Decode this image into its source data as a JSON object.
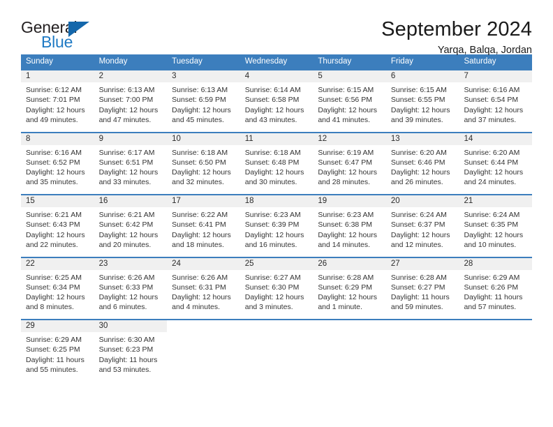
{
  "logo": {
    "part1": "General",
    "part2": "Blue",
    "triangle_icon": "blue-triangle-logo-mark",
    "color_dark": "#231f20",
    "color_blue": "#1f7ac4"
  },
  "header": {
    "title": "September 2024",
    "subtitle": "Yarqa, Balqa, Jordan"
  },
  "theme": {
    "header_bar": "#3c7ebd",
    "day_band": "#f0f0f0",
    "text": "#333333"
  },
  "weekdays": [
    "Sunday",
    "Monday",
    "Tuesday",
    "Wednesday",
    "Thursday",
    "Friday",
    "Saturday"
  ],
  "weeks": [
    [
      {
        "day": "1",
        "sunrise": "Sunrise: 6:12 AM",
        "sunset": "Sunset: 7:01 PM",
        "daylight1": "Daylight: 12 hours",
        "daylight2": "and 49 minutes."
      },
      {
        "day": "2",
        "sunrise": "Sunrise: 6:13 AM",
        "sunset": "Sunset: 7:00 PM",
        "daylight1": "Daylight: 12 hours",
        "daylight2": "and 47 minutes."
      },
      {
        "day": "3",
        "sunrise": "Sunrise: 6:13 AM",
        "sunset": "Sunset: 6:59 PM",
        "daylight1": "Daylight: 12 hours",
        "daylight2": "and 45 minutes."
      },
      {
        "day": "4",
        "sunrise": "Sunrise: 6:14 AM",
        "sunset": "Sunset: 6:58 PM",
        "daylight1": "Daylight: 12 hours",
        "daylight2": "and 43 minutes."
      },
      {
        "day": "5",
        "sunrise": "Sunrise: 6:15 AM",
        "sunset": "Sunset: 6:56 PM",
        "daylight1": "Daylight: 12 hours",
        "daylight2": "and 41 minutes."
      },
      {
        "day": "6",
        "sunrise": "Sunrise: 6:15 AM",
        "sunset": "Sunset: 6:55 PM",
        "daylight1": "Daylight: 12 hours",
        "daylight2": "and 39 minutes."
      },
      {
        "day": "7",
        "sunrise": "Sunrise: 6:16 AM",
        "sunset": "Sunset: 6:54 PM",
        "daylight1": "Daylight: 12 hours",
        "daylight2": "and 37 minutes."
      }
    ],
    [
      {
        "day": "8",
        "sunrise": "Sunrise: 6:16 AM",
        "sunset": "Sunset: 6:52 PM",
        "daylight1": "Daylight: 12 hours",
        "daylight2": "and 35 minutes."
      },
      {
        "day": "9",
        "sunrise": "Sunrise: 6:17 AM",
        "sunset": "Sunset: 6:51 PM",
        "daylight1": "Daylight: 12 hours",
        "daylight2": "and 33 minutes."
      },
      {
        "day": "10",
        "sunrise": "Sunrise: 6:18 AM",
        "sunset": "Sunset: 6:50 PM",
        "daylight1": "Daylight: 12 hours",
        "daylight2": "and 32 minutes."
      },
      {
        "day": "11",
        "sunrise": "Sunrise: 6:18 AM",
        "sunset": "Sunset: 6:48 PM",
        "daylight1": "Daylight: 12 hours",
        "daylight2": "and 30 minutes."
      },
      {
        "day": "12",
        "sunrise": "Sunrise: 6:19 AM",
        "sunset": "Sunset: 6:47 PM",
        "daylight1": "Daylight: 12 hours",
        "daylight2": "and 28 minutes."
      },
      {
        "day": "13",
        "sunrise": "Sunrise: 6:20 AM",
        "sunset": "Sunset: 6:46 PM",
        "daylight1": "Daylight: 12 hours",
        "daylight2": "and 26 minutes."
      },
      {
        "day": "14",
        "sunrise": "Sunrise: 6:20 AM",
        "sunset": "Sunset: 6:44 PM",
        "daylight1": "Daylight: 12 hours",
        "daylight2": "and 24 minutes."
      }
    ],
    [
      {
        "day": "15",
        "sunrise": "Sunrise: 6:21 AM",
        "sunset": "Sunset: 6:43 PM",
        "daylight1": "Daylight: 12 hours",
        "daylight2": "and 22 minutes."
      },
      {
        "day": "16",
        "sunrise": "Sunrise: 6:21 AM",
        "sunset": "Sunset: 6:42 PM",
        "daylight1": "Daylight: 12 hours",
        "daylight2": "and 20 minutes."
      },
      {
        "day": "17",
        "sunrise": "Sunrise: 6:22 AM",
        "sunset": "Sunset: 6:41 PM",
        "daylight1": "Daylight: 12 hours",
        "daylight2": "and 18 minutes."
      },
      {
        "day": "18",
        "sunrise": "Sunrise: 6:23 AM",
        "sunset": "Sunset: 6:39 PM",
        "daylight1": "Daylight: 12 hours",
        "daylight2": "and 16 minutes."
      },
      {
        "day": "19",
        "sunrise": "Sunrise: 6:23 AM",
        "sunset": "Sunset: 6:38 PM",
        "daylight1": "Daylight: 12 hours",
        "daylight2": "and 14 minutes."
      },
      {
        "day": "20",
        "sunrise": "Sunrise: 6:24 AM",
        "sunset": "Sunset: 6:37 PM",
        "daylight1": "Daylight: 12 hours",
        "daylight2": "and 12 minutes."
      },
      {
        "day": "21",
        "sunrise": "Sunrise: 6:24 AM",
        "sunset": "Sunset: 6:35 PM",
        "daylight1": "Daylight: 12 hours",
        "daylight2": "and 10 minutes."
      }
    ],
    [
      {
        "day": "22",
        "sunrise": "Sunrise: 6:25 AM",
        "sunset": "Sunset: 6:34 PM",
        "daylight1": "Daylight: 12 hours",
        "daylight2": "and 8 minutes."
      },
      {
        "day": "23",
        "sunrise": "Sunrise: 6:26 AM",
        "sunset": "Sunset: 6:33 PM",
        "daylight1": "Daylight: 12 hours",
        "daylight2": "and 6 minutes."
      },
      {
        "day": "24",
        "sunrise": "Sunrise: 6:26 AM",
        "sunset": "Sunset: 6:31 PM",
        "daylight1": "Daylight: 12 hours",
        "daylight2": "and 4 minutes."
      },
      {
        "day": "25",
        "sunrise": "Sunrise: 6:27 AM",
        "sunset": "Sunset: 6:30 PM",
        "daylight1": "Daylight: 12 hours",
        "daylight2": "and 3 minutes."
      },
      {
        "day": "26",
        "sunrise": "Sunrise: 6:28 AM",
        "sunset": "Sunset: 6:29 PM",
        "daylight1": "Daylight: 12 hours",
        "daylight2": "and 1 minute."
      },
      {
        "day": "27",
        "sunrise": "Sunrise: 6:28 AM",
        "sunset": "Sunset: 6:27 PM",
        "daylight1": "Daylight: 11 hours",
        "daylight2": "and 59 minutes."
      },
      {
        "day": "28",
        "sunrise": "Sunrise: 6:29 AM",
        "sunset": "Sunset: 6:26 PM",
        "daylight1": "Daylight: 11 hours",
        "daylight2": "and 57 minutes."
      }
    ],
    [
      {
        "day": "29",
        "sunrise": "Sunrise: 6:29 AM",
        "sunset": "Sunset: 6:25 PM",
        "daylight1": "Daylight: 11 hours",
        "daylight2": "and 55 minutes."
      },
      {
        "day": "30",
        "sunrise": "Sunrise: 6:30 AM",
        "sunset": "Sunset: 6:23 PM",
        "daylight1": "Daylight: 11 hours",
        "daylight2": "and 53 minutes."
      },
      {
        "day": "",
        "sunrise": "",
        "sunset": "",
        "daylight1": "",
        "daylight2": ""
      },
      {
        "day": "",
        "sunrise": "",
        "sunset": "",
        "daylight1": "",
        "daylight2": ""
      },
      {
        "day": "",
        "sunrise": "",
        "sunset": "",
        "daylight1": "",
        "daylight2": ""
      },
      {
        "day": "",
        "sunrise": "",
        "sunset": "",
        "daylight1": "",
        "daylight2": ""
      },
      {
        "day": "",
        "sunrise": "",
        "sunset": "",
        "daylight1": "",
        "daylight2": ""
      }
    ]
  ]
}
